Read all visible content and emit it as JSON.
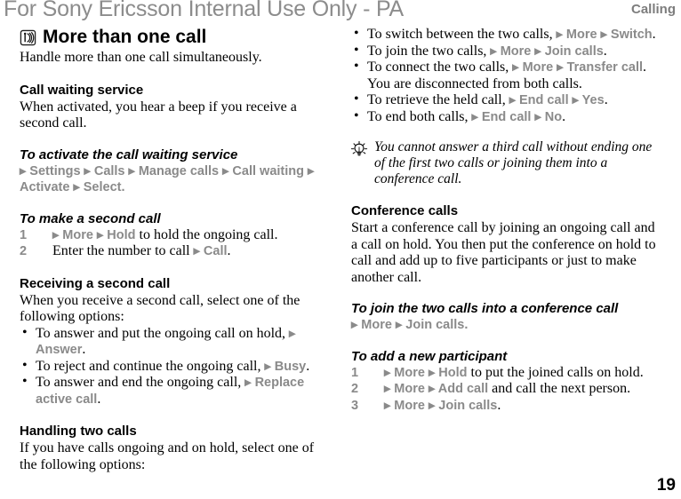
{
  "header": {
    "watermark": "For Sony Ericsson Internal Use Only - PA",
    "running_head": "Calling"
  },
  "footer": {
    "page_number": "19"
  },
  "colors": {
    "menu_reference": "#8a8a8a",
    "watermark": "#8c8c8c",
    "body_text": "#000000"
  },
  "chapter": {
    "icon": "signal-wave-icon",
    "title": "More than one call",
    "intro": "Handle more than one call simultaneously."
  },
  "sections": {
    "call_waiting": {
      "heading": "Call waiting service",
      "body": "When activated, you hear a beep if you receive a second call.",
      "subheading": "To activate the call waiting service",
      "menu_path": "▸ Settings ▸ Calls ▸ Manage calls ▸ Call waiting ▸ Activate ▸ Select."
    },
    "second_call": {
      "subheading": "To make a second call",
      "steps": [
        {
          "num": "1",
          "pre": "▸ More ▸ Hold",
          "post": " to hold the ongoing call."
        },
        {
          "num": "2",
          "pre_text": "Enter the number to call ",
          "ref": "▸ Call",
          "post": "."
        }
      ]
    },
    "receiving": {
      "heading": "Receiving a second call",
      "body": "When you receive a second call, select one of the following options:",
      "bullets": [
        {
          "text": "To answer and put the ongoing call on hold, ",
          "ref": "▸ Answer",
          "tail": "."
        },
        {
          "text": "To reject and continue the ongoing call, ",
          "ref": "▸ Busy",
          "tail": "."
        },
        {
          "text": "To answer and end the ongoing call, ",
          "ref": "▸ Replace active call",
          "tail": "."
        }
      ]
    },
    "handling": {
      "heading": "Handling two calls",
      "body": "If you have calls ongoing and on hold, select one of the following options:",
      "bullets": [
        {
          "text": "To switch between the two calls, ",
          "ref": "▸ More ▸ Switch",
          "tail": "."
        },
        {
          "text": "To join the two calls, ",
          "ref": "▸ More ▸ Join calls",
          "tail": "."
        },
        {
          "text": "To connect the two calls, ",
          "ref": "▸ More ▸ Transfer call",
          "tail": ". You are disconnected from both calls."
        },
        {
          "text": "To retrieve the held call, ",
          "ref": "▸ End call ▸ Yes",
          "tail": "."
        },
        {
          "text": "To end both calls, ",
          "ref": "▸ End call ▸ No",
          "tail": "."
        }
      ]
    },
    "tip": {
      "icon": "lightbulb-tip-icon",
      "text": "You cannot answer a third call without ending one of the first two calls or joining them into a conference call."
    },
    "conference": {
      "heading": "Conference calls",
      "body": "Start a conference call by joining an ongoing call and a call on hold. You then put the conference on hold to call and add up to five participants or just to make another call.",
      "subheading": "To join the two calls into a conference call",
      "menu_path": "▸ More ▸ Join calls."
    },
    "participant": {
      "subheading": "To add a new participant",
      "steps": [
        {
          "num": "1",
          "pre": "▸ More ▸ Hold",
          "post": " to put the joined calls on hold."
        },
        {
          "num": "2",
          "pre": "▸ More ▸ Add call",
          "post": " and call the next person."
        },
        {
          "num": "3",
          "pre": "▸ More ▸ Join calls",
          "post": "."
        }
      ]
    }
  }
}
